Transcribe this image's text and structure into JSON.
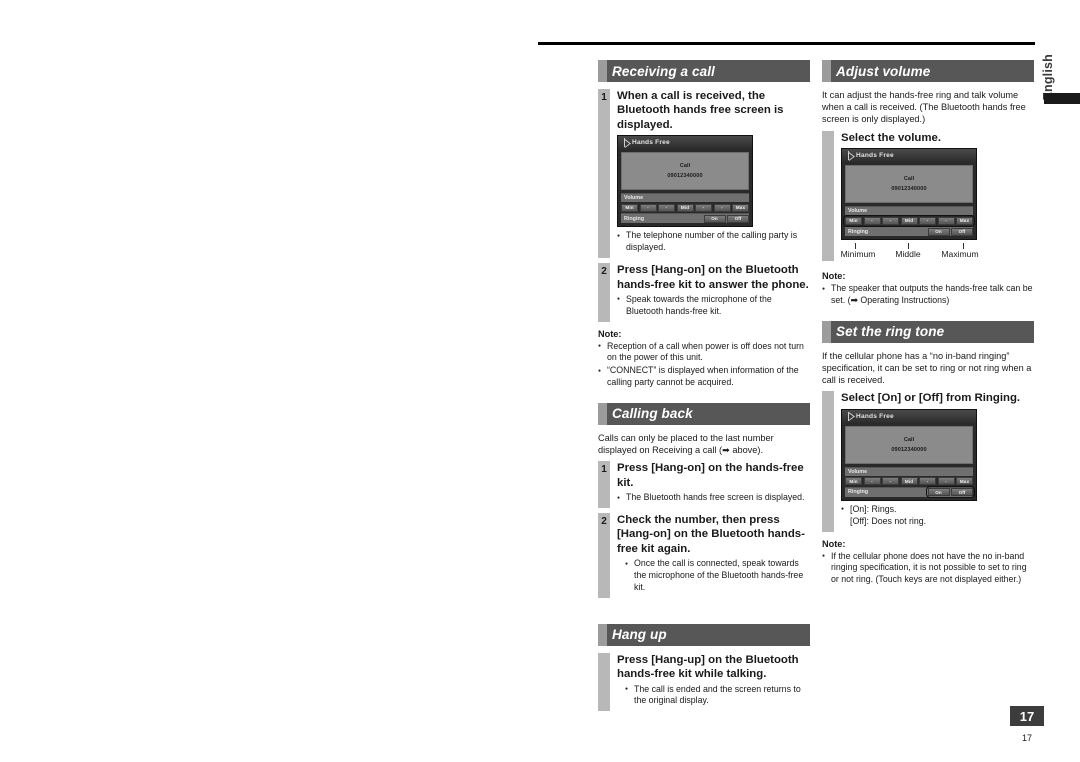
{
  "language_tab": {
    "label": "English"
  },
  "page": {
    "number_badge": "17",
    "number_footer": "17"
  },
  "device_screen": {
    "title": "Hands Free",
    "call_label": "Call",
    "call_number": "09012340000",
    "volume_label": "Volume",
    "ringing_label": "Ringing",
    "volume_keys": [
      "Min",
      "-",
      "-",
      "Mid",
      "-",
      "-",
      "Max"
    ],
    "ring_keys": [
      "On",
      "Off"
    ]
  },
  "left_column": {
    "sections": [
      {
        "id": "receiving-a-call",
        "title": "Receiving a call",
        "steps": [
          {
            "num": "1",
            "title": "When a call is received, the Bluetooth hands free screen is displayed.",
            "bullets": [
              "The telephone number of the calling party is displayed."
            ]
          },
          {
            "num": "2",
            "title": "Press [Hang-on] on the Bluetooth hands-free kit to answer the phone.",
            "bullets": [
              "Speak towards the microphone of the Bluetooth hands-free kit."
            ]
          }
        ],
        "note_label": "Note:",
        "notes": [
          "Reception of a call when power is off does not turn on the power of this unit.",
          "“CONNECT” is displayed when information of the calling party cannot be acquired."
        ]
      },
      {
        "id": "calling-back",
        "title": "Calling back",
        "intro": "Calls can only be placed to the last number displayed on Receiving a call (➡ above).",
        "steps": [
          {
            "num": "1",
            "title": "Press [Hang-on] on the hands-free kit.",
            "bullets": [
              "The Bluetooth hands free screen is displayed."
            ]
          },
          {
            "num": "2",
            "title": "Check the number, then press [Hang-on] on the Bluetooth hands-free kit again.",
            "bullets": [
              "Once the call is connected, speak towards the microphone of the Bluetooth hands-free kit."
            ]
          }
        ]
      },
      {
        "id": "hang-up",
        "title": "Hang up",
        "steps": [
          {
            "num": "",
            "title": "Press [Hang-up] on the Bluetooth hands-free kit while talking.",
            "bullets": [
              "The call is ended and the screen returns to the original display."
            ]
          }
        ]
      }
    ]
  },
  "right_column": {
    "sections": [
      {
        "id": "adjust-volume",
        "title": "Adjust volume",
        "intro": "It can adjust the hands-free ring and talk volume when a call is received. (The Bluetooth hands free screen is only displayed.)",
        "step_title": "Select the volume.",
        "callouts": [
          "Minimum",
          "Middle",
          "Maximum"
        ],
        "note_label": "Note:",
        "notes": [
          "The speaker that outputs the hands-free talk can be set. (➡ Operating Instructions)"
        ]
      },
      {
        "id": "set-the-ring-tone",
        "title": "Set the ring tone",
        "intro": "If the cellular phone has a “no in-band ringing” specification, it can be set to ring or not ring when a call is received.",
        "step_title": "Select [On] or [Off] from Ringing.",
        "bullets": [
          "[On]: Rings.",
          "[Off]: Does not ring."
        ],
        "note_label": "Note:",
        "notes": [
          "If the cellular phone does not have the no in-band ringing specification, it is not possible to set to ring or not ring. (Touch keys are not displayed either.)"
        ]
      }
    ]
  }
}
